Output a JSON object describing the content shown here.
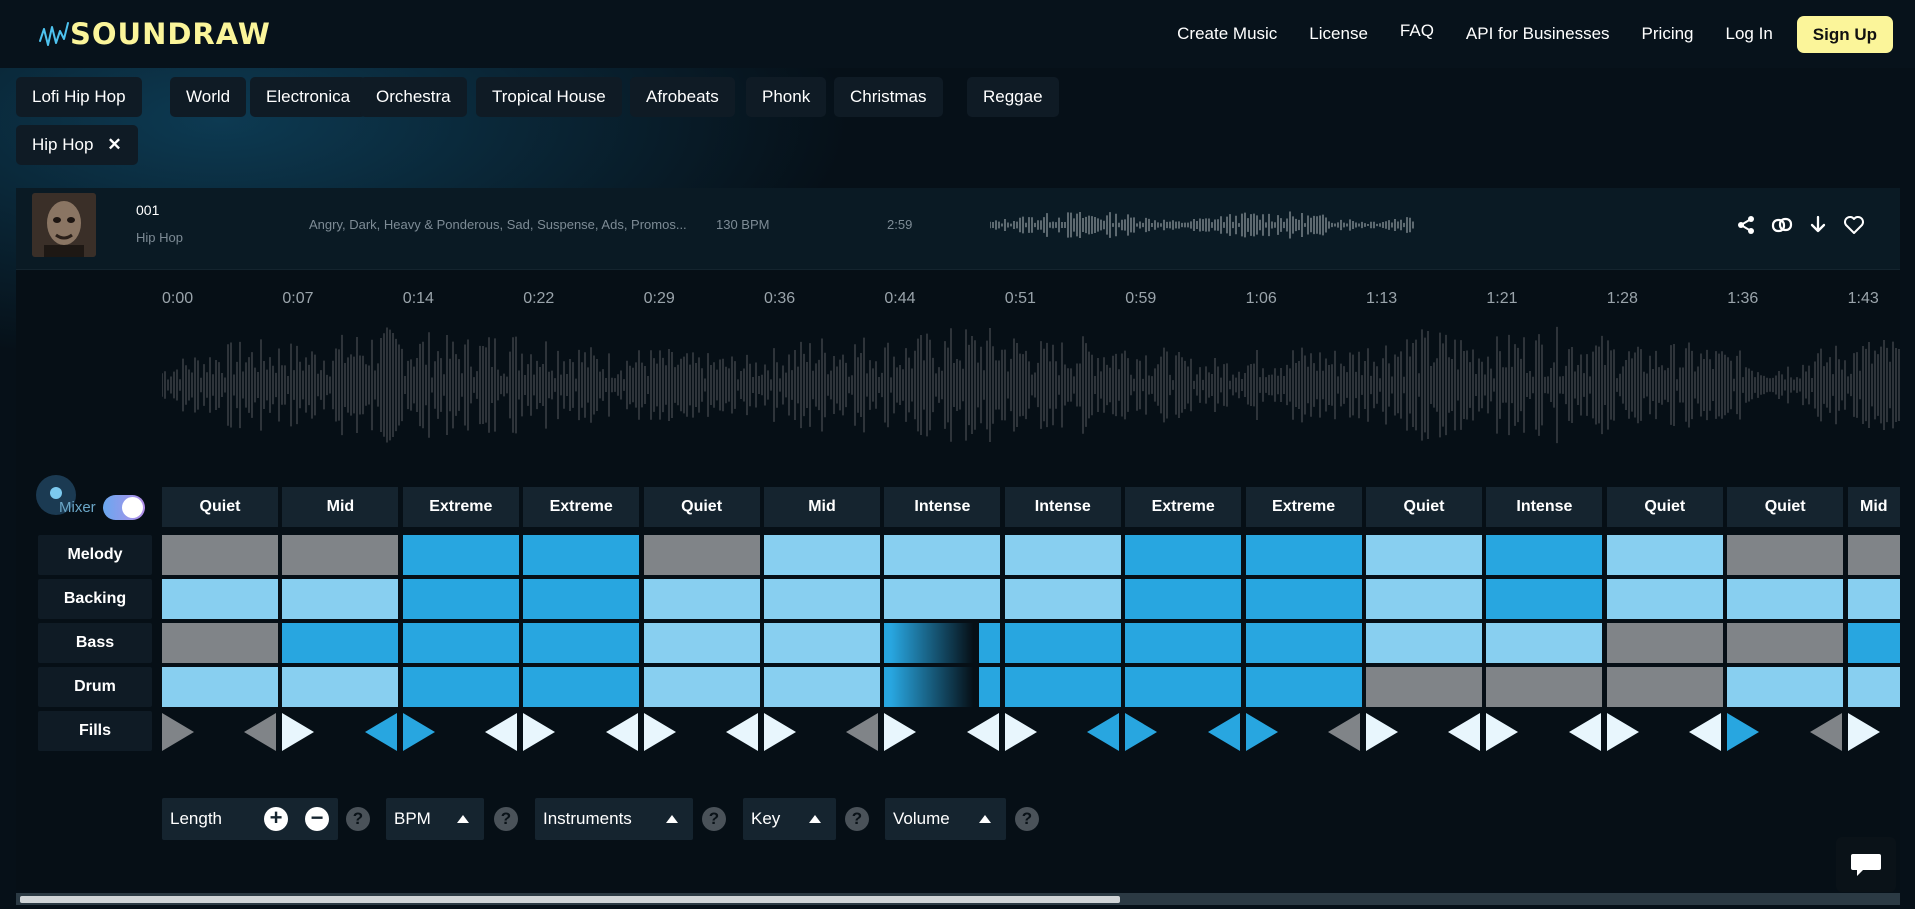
{
  "header": {
    "logo_text": "SOUNDRAW",
    "nav": [
      "Create Music",
      "License",
      "FAQ",
      "API for Businesses",
      "Pricing",
      "Log In"
    ],
    "signup_label": "Sign Up"
  },
  "genres": {
    "items": [
      "Lofi Hip Hop",
      "World",
      "Electronica",
      "Orchestra",
      "Tropical House",
      "Afrobeats",
      "Phonk",
      "Christmas",
      "Reggae"
    ],
    "selected": "Hip Hop",
    "selected_remove": "✕"
  },
  "track": {
    "title": "001",
    "genre": "Hip Hop",
    "tags": "Angry, Dark, Heavy & Ponderous, Sad, Suspense, Ads, Promos...",
    "bpm": "130 BPM",
    "duration": "2:59",
    "actions": [
      "share-icon",
      "link-icon",
      "download-icon",
      "heart-icon"
    ]
  },
  "timeline": [
    "0:00",
    "0:07",
    "0:14",
    "0:22",
    "0:29",
    "0:36",
    "0:44",
    "0:51",
    "0:59",
    "1:06",
    "1:13",
    "1:21",
    "1:28",
    "1:36",
    "1:43"
  ],
  "mixer": {
    "label": "Mixer",
    "enabled": true,
    "row_labels": [
      "Melody",
      "Backing",
      "Bass",
      "Drum",
      "Fills"
    ],
    "energy": [
      "Quiet",
      "Mid",
      "Extreme",
      "Extreme",
      "Quiet",
      "Mid",
      "Intense",
      "Intense",
      "Extreme",
      "Extreme",
      "Quiet",
      "Intense",
      "Quiet",
      "Quiet",
      "Mid"
    ],
    "levels": {
      "melody": [
        "off",
        "off",
        "high",
        "high",
        "off",
        "low",
        "low",
        "low",
        "high",
        "high",
        "low",
        "high",
        "low",
        "off",
        "off"
      ],
      "backing": [
        "low",
        "low",
        "high",
        "high",
        "low",
        "low",
        "low",
        "low",
        "high",
        "high",
        "low",
        "high",
        "low",
        "low",
        "low"
      ],
      "bass": [
        "off",
        "high",
        "high",
        "high",
        "low",
        "low",
        "high",
        "high",
        "high",
        "high",
        "low",
        "low",
        "off",
        "off",
        "high"
      ],
      "drum": [
        "low",
        "low",
        "high",
        "high",
        "low",
        "low",
        "high",
        "high",
        "high",
        "high",
        "off",
        "off",
        "off",
        "low",
        "low"
      ]
    },
    "fills": [
      {
        "left": null,
        "right": "off"
      },
      {
        "left": "off",
        "right": "low"
      },
      {
        "left": "high",
        "right": "high"
      },
      {
        "left": "low",
        "right": "low"
      },
      {
        "left": "low",
        "right": "low"
      },
      {
        "left": "low",
        "right": "low"
      },
      {
        "left": "off",
        "right": "low"
      },
      {
        "left": "low",
        "right": "low"
      },
      {
        "left": "high",
        "right": "high"
      },
      {
        "left": "high",
        "right": "high"
      },
      {
        "left": "off",
        "right": "low"
      },
      {
        "left": "low",
        "right": "low"
      },
      {
        "left": "low",
        "right": "low"
      },
      {
        "left": "low",
        "right": "high"
      },
      {
        "left": "off",
        "right": "low"
      }
    ]
  },
  "controls": {
    "length": "Length",
    "length_add": "+",
    "length_remove": "−",
    "bpm": "BPM",
    "instruments": "Instruments",
    "key": "Key",
    "volume": "Volume",
    "help": "?"
  },
  "colors": {
    "accent": "#fbf59a",
    "level_off": "#808488",
    "level_low": "#88cff0",
    "level_high": "#28a6e0",
    "background": "#061018"
  }
}
